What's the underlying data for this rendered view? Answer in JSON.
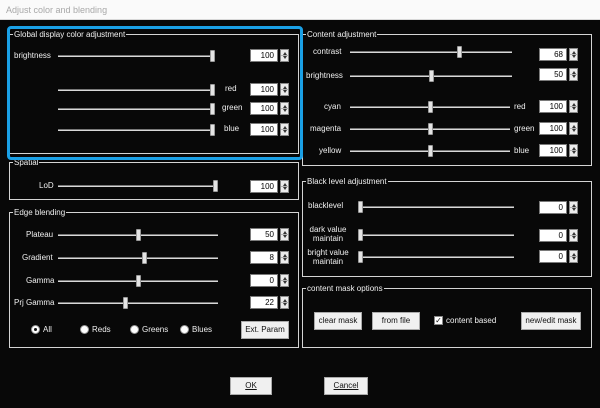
{
  "window": {
    "title": "Adjust color and blending"
  },
  "global": {
    "title": "Global display color adjustment",
    "brightness": {
      "label": "brightness",
      "value": "100",
      "level": 1.0
    },
    "red": {
      "label": "red",
      "value": "100",
      "level": 1.0
    },
    "green": {
      "label": "green",
      "value": "100",
      "level": 1.0
    },
    "blue": {
      "label": "blue",
      "value": "100",
      "level": 1.0
    }
  },
  "spatial": {
    "title": "Spatial",
    "lod": {
      "label": "LoD",
      "value": "100",
      "level": 1.0
    }
  },
  "edge": {
    "title": "Edge blending",
    "plateau": {
      "label": "Plateau",
      "value": "50",
      "level": 0.5
    },
    "gradient": {
      "label": "Gradient",
      "value": "8",
      "level": 0.54
    },
    "gamma": {
      "label": "Gamma",
      "value": "0",
      "level": 0.5
    },
    "prj_gamma": {
      "label": "Prj Gamma",
      "value": "22",
      "level": 0.42
    },
    "radios": {
      "all": "All",
      "reds": "Reds",
      "greens": "Greens",
      "blues": "Blues",
      "selected": "All"
    },
    "ext_param": "Ext. Param"
  },
  "content": {
    "title": "Content adjustment",
    "contrast": {
      "label": "contrast",
      "value": "68",
      "level": 0.68
    },
    "brightness": {
      "label": "brightness",
      "value": "50",
      "level": 0.5
    },
    "cyan": {
      "left": "cyan",
      "right": "red",
      "value": "100",
      "level": 0.5
    },
    "magenta": {
      "left": "magenta",
      "right": "green",
      "value": "100",
      "level": 0.5
    },
    "yellow": {
      "left": "yellow",
      "right": "blue",
      "value": "100",
      "level": 0.5
    }
  },
  "black": {
    "title": "Black level adjustment",
    "blacklevel": {
      "label": "blacklevel",
      "value": "0",
      "level": 0.0
    },
    "dark": {
      "label1": "dark value",
      "label2": "maintain",
      "value": "0",
      "level": 0.0
    },
    "bright": {
      "label1": "bright value",
      "label2": "maintain",
      "value": "0",
      "level": 0.0
    }
  },
  "mask": {
    "title": "content mask options",
    "clear": "clear mask",
    "from_file": "from file",
    "content_based": "content based",
    "content_based_checked": true,
    "new_edit": "new/edit mask"
  },
  "footer": {
    "ok": "OK",
    "cancel": "Cancel"
  }
}
